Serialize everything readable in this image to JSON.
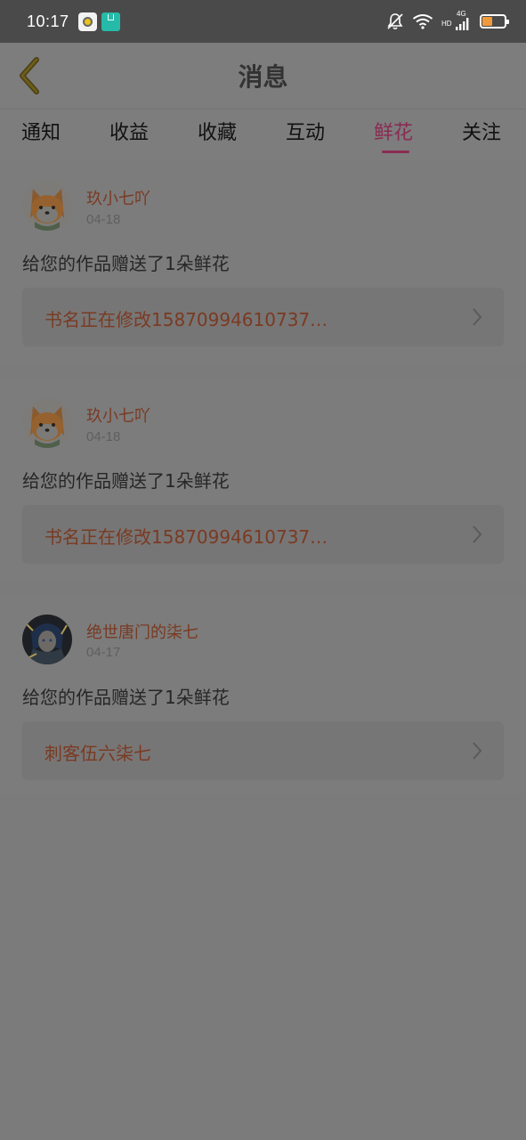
{
  "status_bar": {
    "time": "10:17",
    "network": "4G",
    "hd": "HD",
    "battery_level": 0.45,
    "colors": {
      "bar": "#4a4a4a",
      "battery": "#f09a3e"
    },
    "icons": [
      "app-notification-icon",
      "app-notification-icon-2",
      "mute-bell-icon",
      "wifi-icon",
      "signal-icon",
      "battery-icon"
    ]
  },
  "header": {
    "title": "消息",
    "back_icon": "back-chevron-icon"
  },
  "tabs": [
    {
      "label": "通知",
      "active": false
    },
    {
      "label": "收益",
      "active": false
    },
    {
      "label": "收藏",
      "active": false
    },
    {
      "label": "互动",
      "active": false
    },
    {
      "label": "鲜花",
      "active": true
    },
    {
      "label": "关注",
      "active": false
    }
  ],
  "accent_color": "#8a2b52",
  "messages": [
    {
      "username": "玖小七吖",
      "date": "04-18",
      "text": "给您的作品赠送了1朵鲜花",
      "book": "书名正在修改15870994610737…",
      "avatar": "shiba-avatar"
    },
    {
      "username": "玖小七吖",
      "date": "04-18",
      "text": "给您的作品赠送了1朵鲜花",
      "book": "书名正在修改15870994610737…",
      "avatar": "shiba-avatar"
    },
    {
      "username": "绝世唐门的柒七",
      "date": "04-17",
      "text": "给您的作品赠送了1朵鲜花",
      "book": "刺客伍六柒七",
      "avatar": "anime-avatar"
    }
  ]
}
